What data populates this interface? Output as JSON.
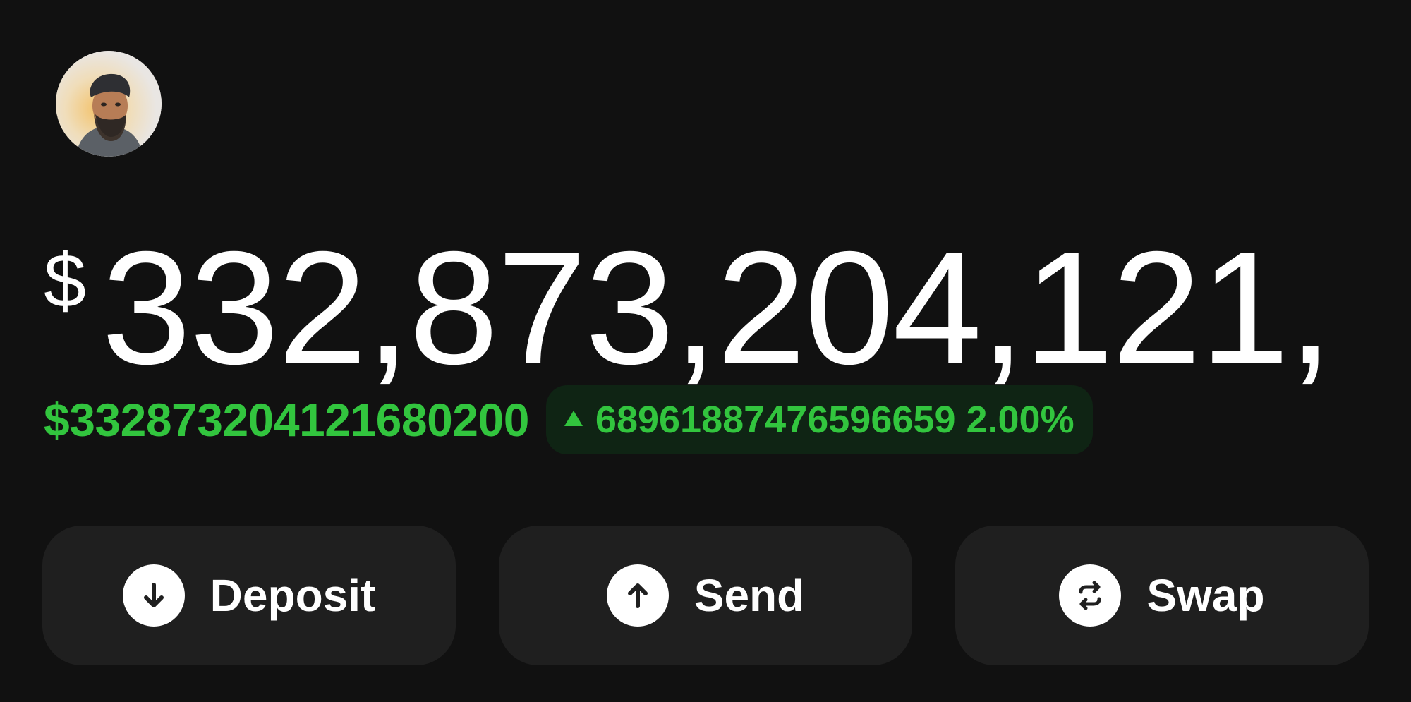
{
  "profile": {
    "avatar_icon": "avatar-photo-icon"
  },
  "balance": {
    "currency_symbol": "$",
    "amount": "332,873,204,121,"
  },
  "change": {
    "value": "$332873204121680200",
    "percent": "68961887476596659 2.00%",
    "direction_icon": "triangle-up-icon",
    "color": "#32c53e",
    "pill_color": "#0f2414"
  },
  "actions": {
    "deposit": {
      "label": "Deposit",
      "icon": "arrow-down-icon"
    },
    "send": {
      "label": "Send",
      "icon": "arrow-up-icon"
    },
    "swap": {
      "label": "Swap",
      "icon": "swap-arrows-icon"
    }
  }
}
